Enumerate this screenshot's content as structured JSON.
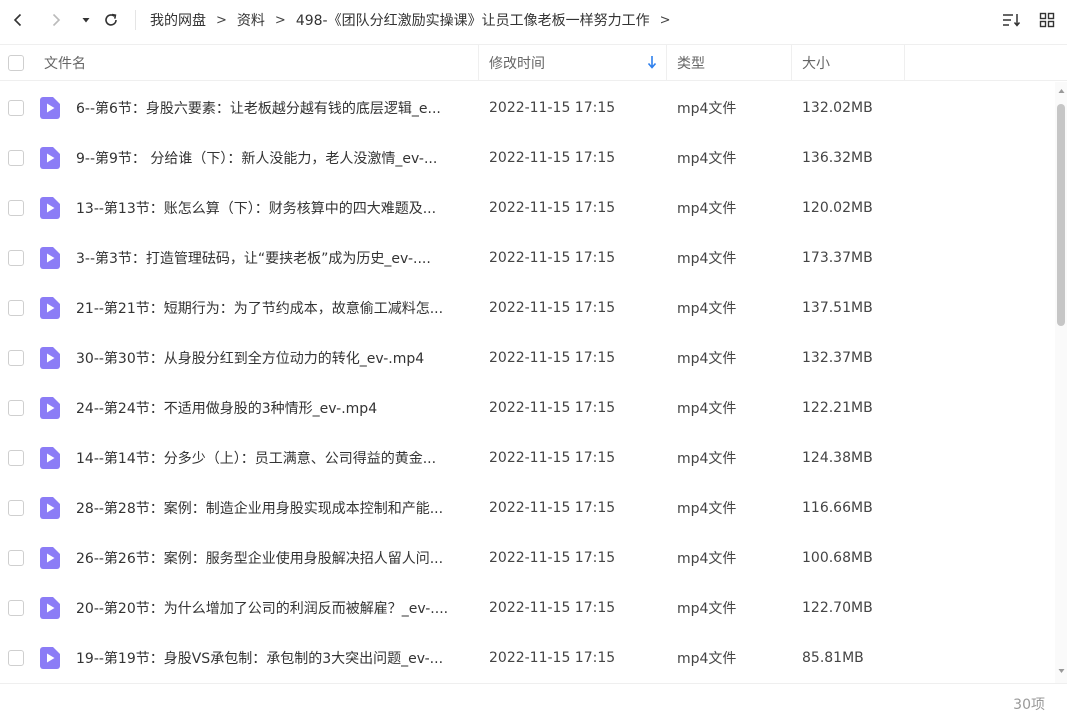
{
  "breadcrumb": {
    "items": [
      "我的网盘",
      "资料",
      "498-《团队分红激励实操课》让员工像老板一样努力工作"
    ],
    "separator": ">"
  },
  "columns": {
    "name": "文件名",
    "modified": "修改时间",
    "type": "类型",
    "size": "大小"
  },
  "files": [
    {
      "name": "6--第6节：身股六要素：让老板越分越有钱的底层逻辑_e...",
      "modified": "2022-11-15 17:15",
      "type": "mp4文件",
      "size": "132.02MB"
    },
    {
      "name": "9--第9节： 分给谁（下）：新人没能力，老人没激情_ev-...",
      "modified": "2022-11-15 17:15",
      "type": "mp4文件",
      "size": "136.32MB"
    },
    {
      "name": "13--第13节：账怎么算（下）：财务核算中的四大难题及...",
      "modified": "2022-11-15 17:15",
      "type": "mp4文件",
      "size": "120.02MB"
    },
    {
      "name": "3--第3节：打造管理砝码，让“要挟老板”成为历史_ev-....",
      "modified": "2022-11-15 17:15",
      "type": "mp4文件",
      "size": "173.37MB"
    },
    {
      "name": "21--第21节：短期行为：为了节约成本，故意偷工减料怎...",
      "modified": "2022-11-15 17:15",
      "type": "mp4文件",
      "size": "137.51MB"
    },
    {
      "name": "30--第30节：从身股分红到全方位动力的转化_ev-.mp4",
      "modified": "2022-11-15 17:15",
      "type": "mp4文件",
      "size": "132.37MB"
    },
    {
      "name": "24--第24节：不适用做身股的3种情形_ev-.mp4",
      "modified": "2022-11-15 17:15",
      "type": "mp4文件",
      "size": "122.21MB"
    },
    {
      "name": "14--第14节：分多少（上）：员工满意、公司得益的黄金...",
      "modified": "2022-11-15 17:15",
      "type": "mp4文件",
      "size": "124.38MB"
    },
    {
      "name": "28--第28节：案例：制造企业用身股实现成本控制和产能...",
      "modified": "2022-11-15 17:15",
      "type": "mp4文件",
      "size": "116.66MB"
    },
    {
      "name": "26--第26节：案例：服务型企业使用身股解决招人留人问...",
      "modified": "2022-11-15 17:15",
      "type": "mp4文件",
      "size": "100.68MB"
    },
    {
      "name": "20--第20节：为什么增加了公司的利润反而被解雇？_ev-....",
      "modified": "2022-11-15 17:15",
      "type": "mp4文件",
      "size": "122.70MB"
    },
    {
      "name": "19--第19节：身股VS承包制：承包制的3大突出问题_ev-...",
      "modified": "2022-11-15 17:15",
      "type": "mp4文件",
      "size": "85.81MB"
    }
  ],
  "footer": {
    "count": "30项"
  },
  "colors": {
    "file_icon": "#8b7cf6",
    "sort_arrow": "#2f80ed",
    "divider": "#efefef"
  },
  "icons": {
    "back": "chevron-left-icon",
    "forward": "chevron-right-icon",
    "dropdown": "caret-down-icon",
    "refresh": "refresh-icon",
    "sort": "sort-icon",
    "view": "grid-view-icon",
    "file": "video-file-icon"
  }
}
